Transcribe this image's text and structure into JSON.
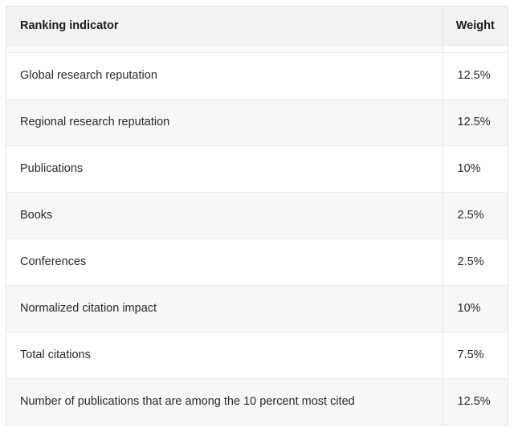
{
  "table": {
    "columns": [
      {
        "key": "indicator",
        "label": "Ranking indicator"
      },
      {
        "key": "weight",
        "label": "Weight"
      }
    ],
    "rows": [
      {
        "indicator": "Global research reputation",
        "weight": "12.5%"
      },
      {
        "indicator": "Regional research reputation",
        "weight": "12.5%"
      },
      {
        "indicator": "Publications",
        "weight": "10%"
      },
      {
        "indicator": "Books",
        "weight": "2.5%"
      },
      {
        "indicator": "Conferences",
        "weight": "2.5%"
      },
      {
        "indicator": "Normalized citation impact",
        "weight": "10%"
      },
      {
        "indicator": "Total citations",
        "weight": "7.5%"
      },
      {
        "indicator": "Number of publications that are among the 10 percent most cited",
        "weight": "12.5%"
      }
    ]
  },
  "colors": {
    "header_background": "#f2f2f2",
    "row_background_odd": "#ffffff",
    "row_background_even": "#f7f7f7",
    "border": "#e4e4e4",
    "text": "#2a2a2a",
    "header_text": "#1b1b1b"
  }
}
